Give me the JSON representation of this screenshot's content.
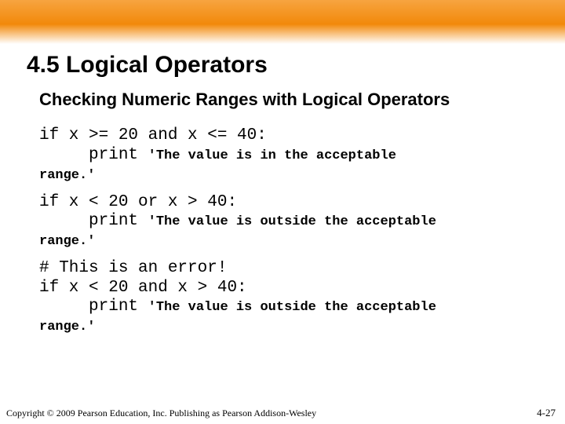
{
  "title": "4.5 Logical Operators",
  "subtitle": "Checking Numeric Ranges with Logical Operators",
  "code": {
    "block1": {
      "line1": "if x >= 20 and x <= 40:",
      "line2_lead": "     print ",
      "line2_str": "'The value is in the acceptable",
      "tail": "range.'"
    },
    "block2": {
      "line1": "if x < 20 or x > 40:",
      "line2_lead": "     print ",
      "line2_str": "'The value is outside the acceptable",
      "tail": "range.'"
    },
    "block3": {
      "line0": "# This is an error!",
      "line1": "if x < 20 and x > 40:",
      "line2_lead": "     print ",
      "line2_str": "'The value is outside the acceptable",
      "tail": "range.'"
    }
  },
  "footer": "Copyright © 2009 Pearson Education, Inc. Publishing as Pearson Addison-Wesley",
  "pagenum": "4-27"
}
